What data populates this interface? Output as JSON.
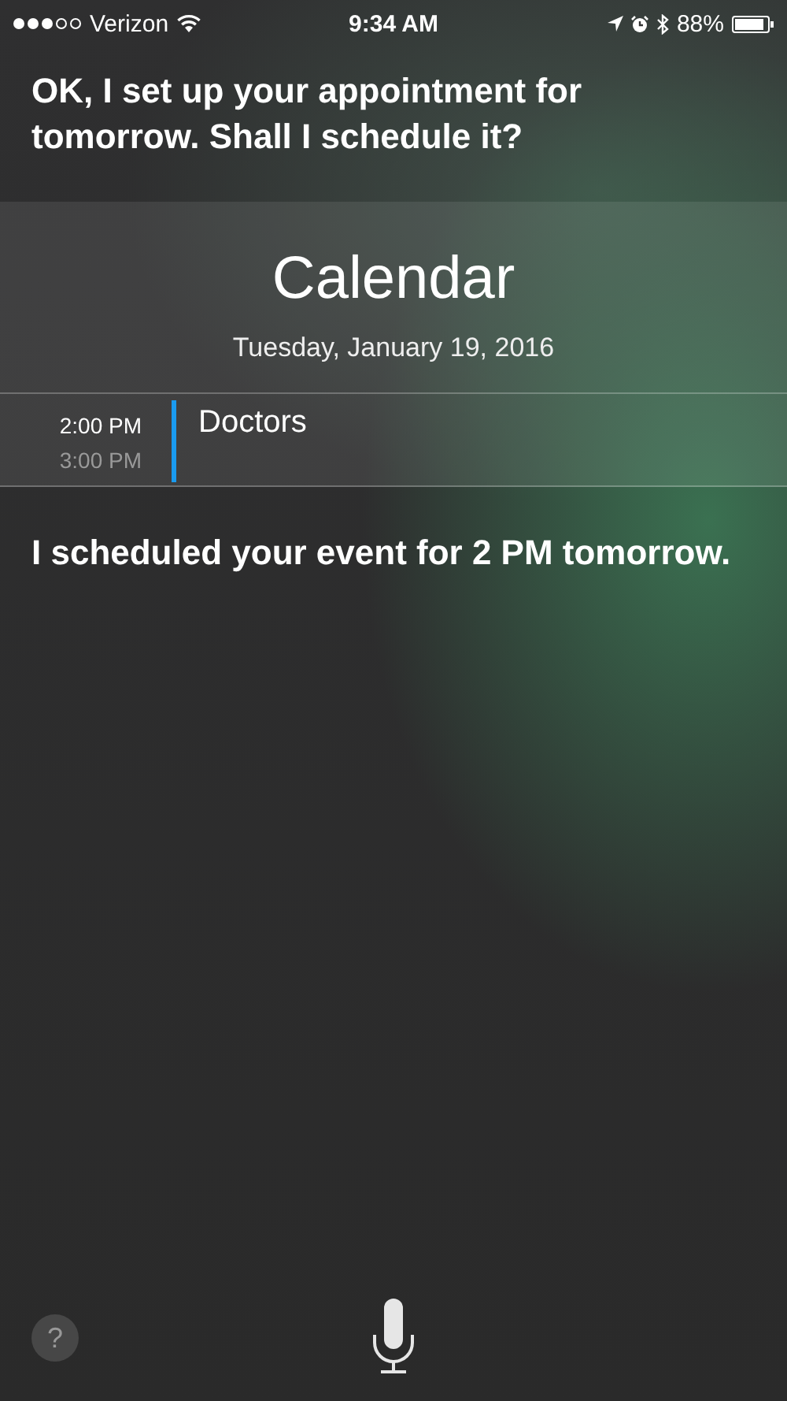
{
  "status_bar": {
    "carrier": "Verizon",
    "time": "9:34 AM",
    "battery": "88%"
  },
  "siri_prompt": "OK, I set up your appointment for tomorrow. Shall I schedule it?",
  "calendar": {
    "title": "Calendar",
    "date": "Tuesday, January 19, 2016",
    "events": [
      {
        "start": "2:00 PM",
        "end": "3:00 PM",
        "title": "Doctors",
        "color": "#1a9bf0"
      }
    ]
  },
  "siri_response": "I scheduled your event for 2 PM tomorrow.",
  "help_button": "?"
}
